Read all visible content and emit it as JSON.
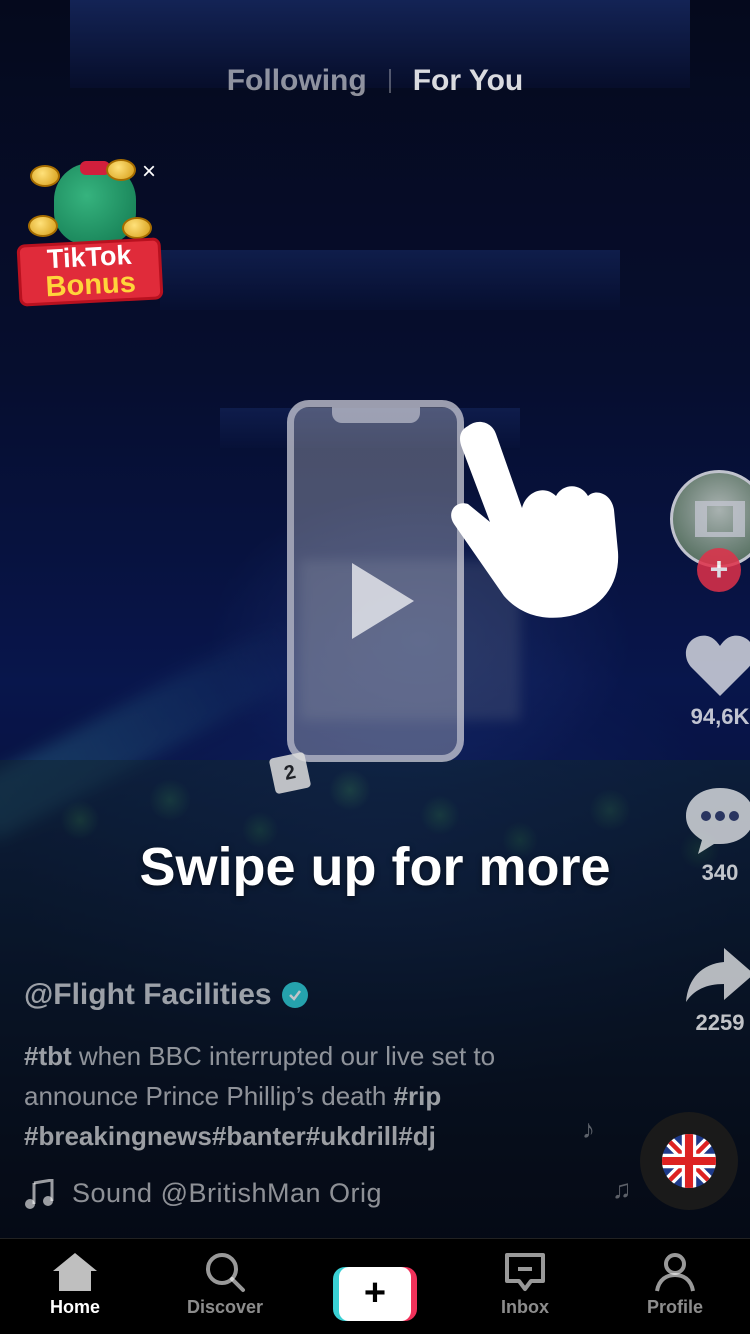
{
  "top_tabs": {
    "following": "Following",
    "for_you": "For You"
  },
  "bonus": {
    "line1": "TikTok",
    "line2": "Bonus",
    "close": "×"
  },
  "tutorial": {
    "text": "Swipe up for more"
  },
  "sticker": "2",
  "rail": {
    "likes": "94,6K",
    "comments": "340",
    "shares": "2259",
    "follow_symbol": "+"
  },
  "caption": {
    "username": "@Flight Facilities",
    "desc_tag1": "#tbt",
    "desc_text": " when BBC interrupted our live set to announce Prince Phillip’s death ",
    "desc_tag2": "#rip",
    "desc_tags_line": "#breakingnews#banter#ukdrill#dj",
    "sound": "Sound    @BritishMan Orig"
  },
  "nav": {
    "home": "Home",
    "discover": "Discover",
    "create_symbol": "+",
    "inbox": "Inbox",
    "profile": "Profile"
  },
  "colors": {
    "like_red": "#e0314a",
    "create_cyan": "#3ad0d4",
    "create_pink": "#f0315a",
    "verified": "#2fd1d9"
  }
}
